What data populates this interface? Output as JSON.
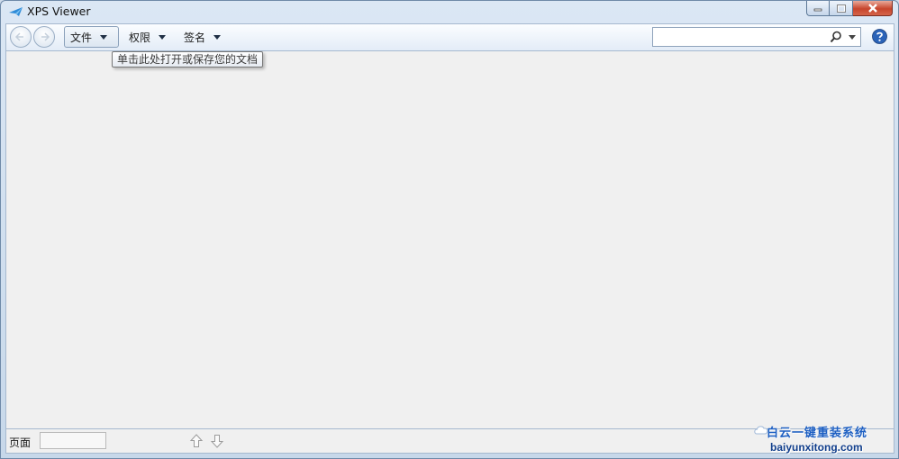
{
  "window": {
    "title": "XPS Viewer"
  },
  "toolbar": {
    "menus": [
      {
        "label": "文件"
      },
      {
        "label": "权限"
      },
      {
        "label": "签名"
      }
    ],
    "search": {
      "value": "",
      "placeholder": ""
    }
  },
  "tooltip": {
    "text": "单击此处打开或保存您的文档"
  },
  "statusbar": {
    "page_label": "页面",
    "page_value": ""
  },
  "watermark": {
    "title": "白云一键重装系统",
    "url": "baiyunxitong.com"
  },
  "colors": {
    "accent": "#1d5fc2",
    "close": "#c7452c",
    "doc_bg": "#f0f0f0"
  }
}
